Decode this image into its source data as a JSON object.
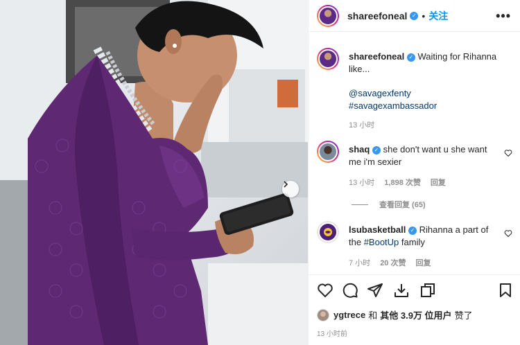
{
  "post": {
    "author": "shareefoneal",
    "follow_label": "关注",
    "separator": "•",
    "more_label": "•••",
    "caption": "Waiting for Rihanna like...",
    "hashtag_mention": "@savagexfenty",
    "hashtag": "#savagexambassador",
    "caption_time": "13 小时"
  },
  "comments": [
    {
      "username": "shaq",
      "text": "she don't want u she want me i'm sexier",
      "time": "13 小时",
      "likes": "1,898 次赞",
      "reply_label": "回复",
      "view_replies": "查看回复 (65)"
    },
    {
      "username": "lsubasketball",
      "text_before": "Rihanna a part of the ",
      "tag": "#BootUp",
      "text_after": " family",
      "time": "7 小时",
      "likes": "20 次赞",
      "reply_label": "回复"
    }
  ],
  "likes_line": {
    "user": "ygtrece",
    "and": "和",
    "others": "其他 3.9万 位用户",
    "suffix": "赞了"
  },
  "post_time": "13 小时前",
  "icons": {
    "verified": "verified-badge-icon",
    "heart": "heart-icon",
    "comment": "comment-icon",
    "share": "send-icon",
    "download": "download-icon",
    "copy": "copy-icon",
    "save": "bookmark-icon",
    "next": "chevron-right-icon"
  },
  "colors": {
    "link": "#00376b",
    "follow": "#0095f6",
    "verified": "#3897f0",
    "robe": "#5e2873",
    "muted": "#8e8e8e"
  }
}
